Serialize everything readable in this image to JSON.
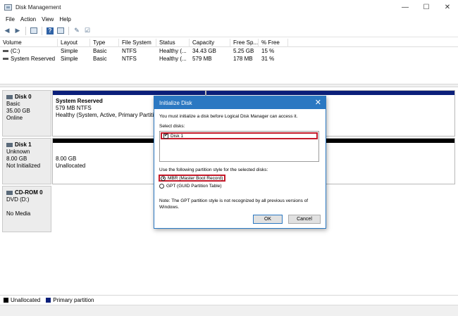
{
  "window": {
    "title": "Disk Management",
    "controls": {
      "minimize": "—",
      "maximize": "☐",
      "close": "✕"
    }
  },
  "menu": [
    "File",
    "Action",
    "View",
    "Help"
  ],
  "toolbar": {
    "icons": [
      "back-icon",
      "forward-icon",
      "disk-view-icon",
      "help-icon",
      "refresh-icon",
      "properties-icon",
      "check-icon"
    ]
  },
  "volumes": {
    "headers": [
      "Volume",
      "Layout",
      "Type",
      "File System",
      "Status",
      "Capacity",
      "Free Sp...",
      "% Free"
    ],
    "rows": [
      [
        "(C:)",
        "Simple",
        "Basic",
        "NTFS",
        "Healthy (...",
        "34.43 GB",
        "5.25 GB",
        "15 %"
      ],
      [
        "System Reserved",
        "Simple",
        "Basic",
        "NTFS",
        "Healthy (...",
        "579 MB",
        "178 MB",
        "31 %"
      ]
    ]
  },
  "disks": {
    "disk0": {
      "name": "Disk 0",
      "type": "Basic",
      "size": "35.00 GB",
      "status": "Online",
      "partition": {
        "name": "System Reserved",
        "size": "579 MB NTFS",
        "status": "Healthy (System, Active, Primary Partitio"
      }
    },
    "disk1": {
      "name": "Disk 1",
      "type": "Unknown",
      "size": "8.00 GB",
      "status": "Not Initialized",
      "partition": {
        "size": "8.00 GB",
        "status": "Unallocated"
      }
    },
    "cdrom": {
      "name": "CD-ROM 0",
      "type": "DVD (D:)",
      "status": "No Media"
    }
  },
  "legend": [
    {
      "label": "Unallocated",
      "color": "#000000"
    },
    {
      "label": "Primary partition",
      "color": "#0b1f7a"
    }
  ],
  "dialog": {
    "title": "Initialize Disk",
    "close": "✕",
    "message": "You must initialize a disk before Logical Disk Manager can access it.",
    "select_label": "Select disks:",
    "disk_item": "Disk 1",
    "disk_checked": true,
    "style_label": "Use the following partition style for the selected disks:",
    "mbr_label": "MBR (Master Boot Record)",
    "gpt_label": "GPT (GUID Partition Table)",
    "selected_style": "MBR",
    "note": "Note: The GPT partition style is not recognized by all previous versions of Windows.",
    "ok_label": "OK",
    "cancel_label": "Cancel"
  },
  "colors": {
    "accent": "#2b78c2",
    "highlight": "#c41a2a",
    "primary_partition": "#0b1f7a"
  }
}
